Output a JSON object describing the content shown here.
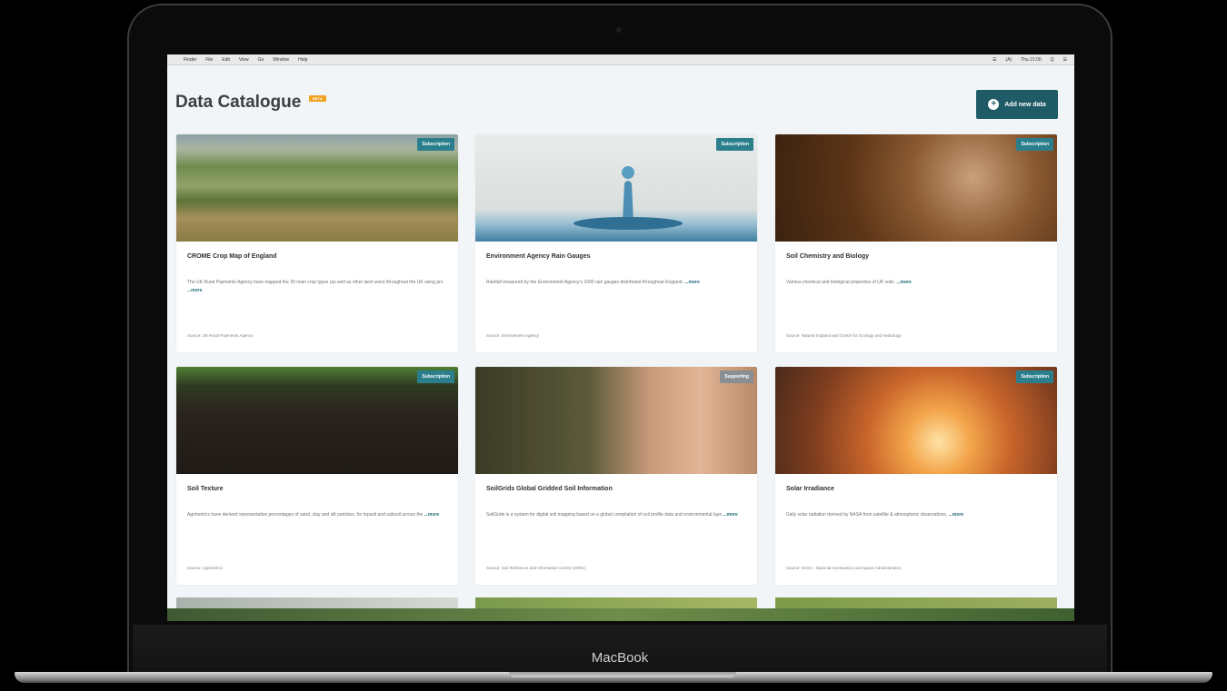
{
  "device": {
    "brand": "MacBook"
  },
  "menubar": {
    "items": [
      "Finder",
      "File",
      "Edit",
      "View",
      "Go",
      "Window",
      "Help"
    ],
    "status": [
      "☰",
      "(A)",
      "Thu 21:00",
      "Q",
      "☰"
    ]
  },
  "header": {
    "title": "Data Catalogue",
    "badge": "BETA",
    "add_button": "Add new data"
  },
  "cards": [
    {
      "title": "CROME Crop Map of England",
      "tag": "Subscription",
      "desc": "The UK Rural Payments Agency have mapped the 30 main crop types (as well as other land uses) throughout the UK using pro",
      "more": "...more",
      "source": "Source: UK Rural Payments Agency"
    },
    {
      "title": "Environment Agency Rain Gauges",
      "tag": "Subscription",
      "desc": "Rainfall measured by the Environment Agency's 1000 rain gauges distributed throughout England.",
      "more": "...more",
      "source": "Source: Environment Agency"
    },
    {
      "title": "Soil Chemistry and Biology",
      "tag": "Subscription",
      "desc": "Various chemical and biological properties of UK soils.",
      "more": "...more",
      "source": "Source: Natural England and Centre for Ecology and Hydrology"
    },
    {
      "title": "Soil Texture",
      "tag": "Subscription",
      "desc": "Agrimetrics have derived representative percentages of sand, clay and silt particles, for topsoil and subsoil across the",
      "more": "...more",
      "source": "Source: Agrimetrics"
    },
    {
      "title": "SoilGrids Global Gridded Soil Information",
      "tag": "Supporting",
      "desc": "SoilGrids is a system for digital soil mapping based on a global compilation of soil profile data and environmental laye",
      "more": "...more",
      "source": "Source: Soil Reference and Information Centre (ISRIC)"
    },
    {
      "title": "Solar Irradiance",
      "tag": "Subscription",
      "desc": "Daily solar radiation derived by NASA from satellite & atmospheric observations.",
      "more": "...more",
      "source": "Source: NASA - National Aeronautics and Space Administration"
    }
  ]
}
